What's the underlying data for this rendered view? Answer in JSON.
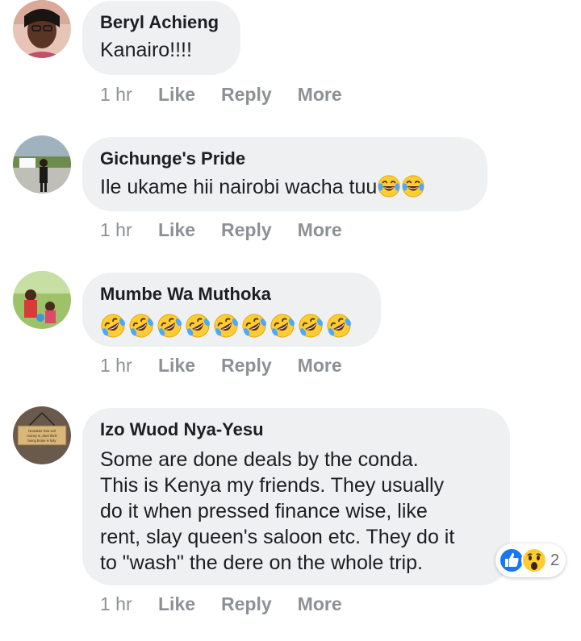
{
  "comments": [
    {
      "author": "Beryl Achieng",
      "text": "Kanairo!!!!",
      "time": "1 hr",
      "like": "Like",
      "reply": "Reply",
      "more": "More"
    },
    {
      "author": "Gichunge's Pride",
      "text": "Ile ukame hii nairobi wacha tuu",
      "emojis": [
        "face-with-tears-of-joy-icon",
        "face-with-tears-of-joy-icon"
      ],
      "time": "1 hr",
      "like": "Like",
      "reply": "Reply",
      "more": "More"
    },
    {
      "author": "Mumbe Wa Muthoka",
      "emojis": [
        "rolling-on-floor-laughing-icon",
        "rolling-on-floor-laughing-icon",
        "rolling-on-floor-laughing-icon",
        "rolling-on-floor-laughing-icon",
        "rolling-on-floor-laughing-icon",
        "rolling-on-floor-laughing-icon",
        "rolling-on-floor-laughing-icon",
        "rolling-on-floor-laughing-icon",
        "rolling-on-floor-laughing-icon"
      ],
      "time": "1 hr",
      "like": "Like",
      "reply": "Reply",
      "more": "More"
    },
    {
      "author": "Izo Wuod Nya-Yesu",
      "avatar_sign_text": "Nomatter how evil money is ,dont think being broke is holy",
      "lines": [
        "Some are done deals by the conda.",
        "This is Kenya my friends. They usually",
        "do it when pressed finance wise, like",
        "rent, slay queen's saloon etc. They do it",
        "to \"wash\" the dere on the whole trip."
      ],
      "reactions": {
        "icons": [
          "like-reaction-icon",
          "wow-reaction-icon"
        ],
        "count": "2"
      },
      "time": "1 hr",
      "like": "Like",
      "reply": "Reply",
      "more": "More"
    }
  ],
  "colors": {
    "bubble": "#eff0f2",
    "action_text": "#8d9095",
    "like_blue": "#1877f2",
    "emoji_yellow": "#ffcc33"
  }
}
